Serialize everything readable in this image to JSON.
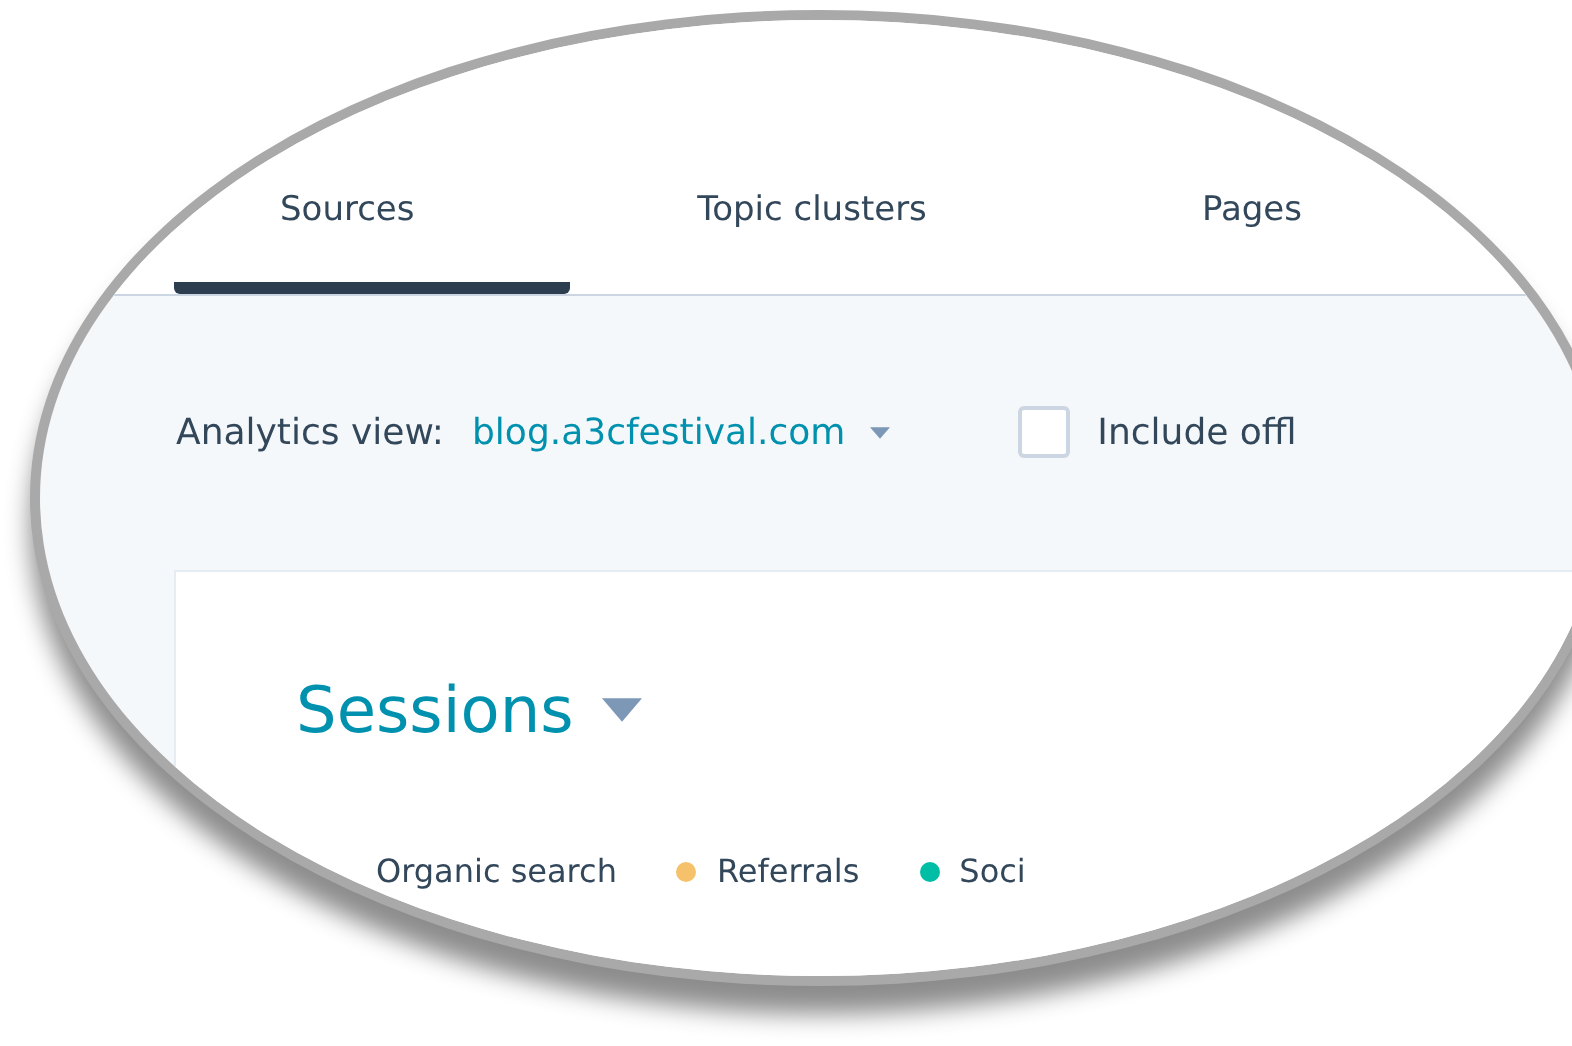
{
  "tabs": [
    {
      "label": "Sources",
      "selected": true
    },
    {
      "label": "Topic clusters",
      "selected": false
    },
    {
      "label": "Pages",
      "selected": false
    }
  ],
  "filters": {
    "label": "Analytics view:",
    "value": "blog.a3cfestival.com",
    "checkbox": {
      "label": "Include offl",
      "checked": false
    }
  },
  "card": {
    "title": "Sessions",
    "legend": [
      {
        "label": "Organic search"
      },
      {
        "label": "Referrals",
        "color": "#f5c26b"
      },
      {
        "label": "Soci",
        "color": "#00bda5"
      }
    ]
  }
}
